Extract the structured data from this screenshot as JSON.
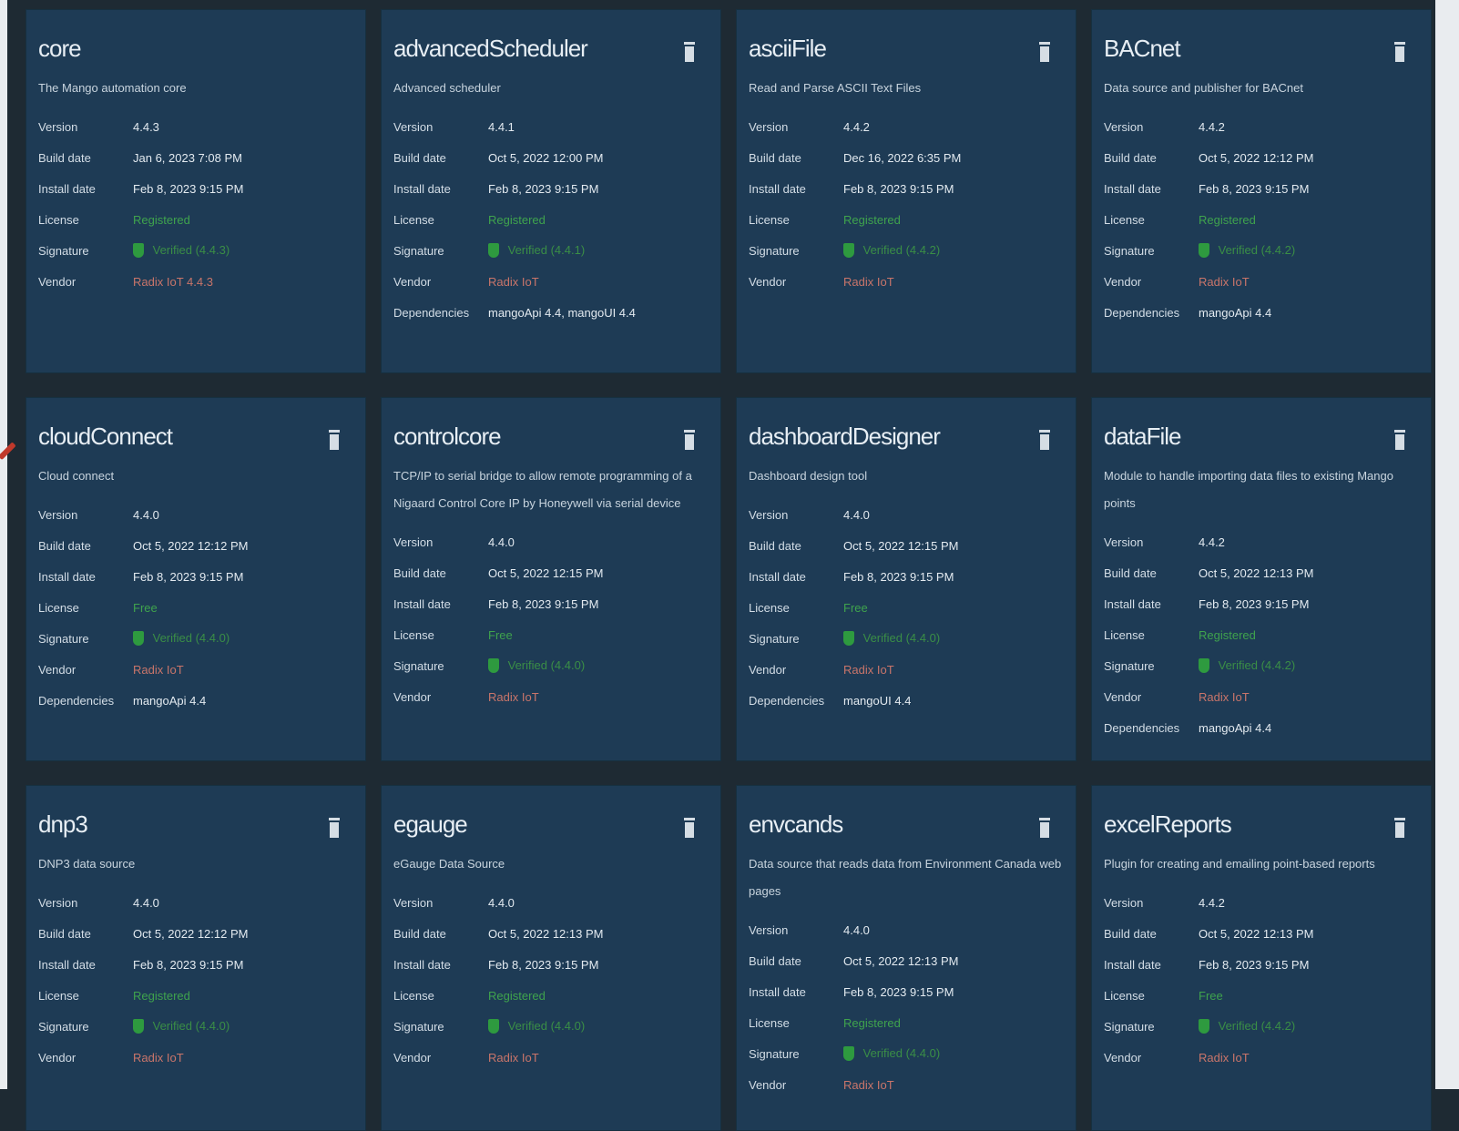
{
  "labels": {
    "version": "Version",
    "build_date": "Build date",
    "install_date": "Install date",
    "license": "License",
    "signature": "Signature",
    "vendor": "Vendor",
    "dependencies": "Dependencies"
  },
  "colors": {
    "background": "#1e2a33",
    "card": "#1e3b55",
    "license_green": "#3fa34d",
    "vendor_red": "#c9756a"
  },
  "cards": [
    {
      "title": "core",
      "desc": "The Mango automation core",
      "version": "4.4.3",
      "build": "Jan 6, 2023 7:08 PM",
      "install": "Feb 8, 2023 9:15 PM",
      "license": "Registered",
      "signature": "Verified (4.4.3)",
      "vendor": "Radix IoT 4.4.3",
      "deps": "",
      "trash": false
    },
    {
      "title": "advancedScheduler",
      "desc": "Advanced scheduler",
      "version": "4.4.1",
      "build": "Oct 5, 2022 12:00 PM",
      "install": "Feb 8, 2023 9:15 PM",
      "license": "Registered",
      "signature": "Verified (4.4.1)",
      "vendor": "Radix IoT",
      "deps": "mangoApi 4.4, mangoUI 4.4",
      "trash": true
    },
    {
      "title": "asciiFile",
      "desc": "Read and Parse ASCII Text Files",
      "version": "4.4.2",
      "build": "Dec 16, 2022 6:35 PM",
      "install": "Feb 8, 2023 9:15 PM",
      "license": "Registered",
      "signature": "Verified (4.4.2)",
      "vendor": "Radix IoT",
      "deps": "",
      "trash": true
    },
    {
      "title": "BACnet",
      "desc": "Data source and publisher for BACnet",
      "version": "4.4.2",
      "build": "Oct 5, 2022 12:12 PM",
      "install": "Feb 8, 2023 9:15 PM",
      "license": "Registered",
      "signature": "Verified (4.4.2)",
      "vendor": "Radix IoT",
      "deps": "mangoApi 4.4",
      "trash": true
    },
    {
      "title": "cloudConnect",
      "desc": "Cloud connect",
      "version": "4.4.0",
      "build": "Oct 5, 2022 12:12 PM",
      "install": "Feb 8, 2023 9:15 PM",
      "license": "Free",
      "signature": "Verified (4.4.0)",
      "vendor": "Radix IoT",
      "deps": "mangoApi 4.4",
      "trash": true
    },
    {
      "title": "controlcore",
      "desc": "TCP/IP to serial bridge to allow remote programming of a Nigaard Control Core IP by Honeywell via serial device",
      "version": "4.4.0",
      "build": "Oct 5, 2022 12:15 PM",
      "install": "Feb 8, 2023 9:15 PM",
      "license": "Free",
      "signature": "Verified (4.4.0)",
      "vendor": "Radix IoT",
      "deps": "",
      "trash": true
    },
    {
      "title": "dashboardDesigner",
      "desc": "Dashboard design tool",
      "version": "4.4.0",
      "build": "Oct 5, 2022 12:15 PM",
      "install": "Feb 8, 2023 9:15 PM",
      "license": "Free",
      "signature": "Verified (4.4.0)",
      "vendor": "Radix IoT",
      "deps": "mangoUI 4.4",
      "trash": true
    },
    {
      "title": "dataFile",
      "desc": "Module to handle importing data files to existing Mango points",
      "version": "4.4.2",
      "build": "Oct 5, 2022 12:13 PM",
      "install": "Feb 8, 2023 9:15 PM",
      "license": "Registered",
      "signature": "Verified (4.4.2)",
      "vendor": "Radix IoT",
      "deps": "mangoApi 4.4",
      "trash": true
    },
    {
      "title": "dnp3",
      "desc": "DNP3 data source",
      "version": "4.4.0",
      "build": "Oct 5, 2022 12:12 PM",
      "install": "Feb 8, 2023 9:15 PM",
      "license": "Registered",
      "signature": "Verified (4.4.0)",
      "vendor": "Radix IoT",
      "deps": "",
      "trash": true
    },
    {
      "title": "egauge",
      "desc": "eGauge Data Source",
      "version": "4.4.0",
      "build": "Oct 5, 2022 12:13 PM",
      "install": "Feb 8, 2023 9:15 PM",
      "license": "Registered",
      "signature": "Verified (4.4.0)",
      "vendor": "Radix IoT",
      "deps": "",
      "trash": true
    },
    {
      "title": "envcands",
      "desc": "Data source that reads data from Environment Canada web pages",
      "version": "4.4.0",
      "build": "Oct 5, 2022 12:13 PM",
      "install": "Feb 8, 2023 9:15 PM",
      "license": "Registered",
      "signature": "Verified (4.4.0)",
      "vendor": "Radix IoT",
      "deps": "",
      "trash": true
    },
    {
      "title": "excelReports",
      "desc": "Plugin for creating and emailing point-based reports",
      "version": "4.4.2",
      "build": "Oct 5, 2022 12:13 PM",
      "install": "Feb 8, 2023 9:15 PM",
      "license": "Free",
      "signature": "Verified (4.4.2)",
      "vendor": "Radix IoT",
      "deps": "",
      "trash": true
    }
  ]
}
